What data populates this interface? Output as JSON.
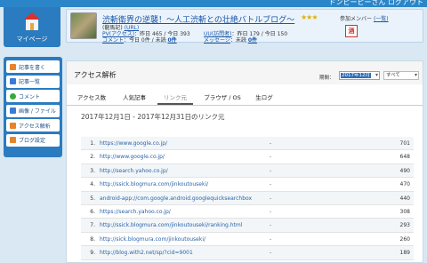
{
  "top": {
    "user_text": "ドンピーピーさん  ログアウト"
  },
  "mypage": {
    "label": "マイページ"
  },
  "sidebar": {
    "items": [
      {
        "label": "記事を書く",
        "color": "#e8832a"
      },
      {
        "label": "記事一覧",
        "color": "#3a7bd5"
      },
      {
        "label": "コメント",
        "color": "#3aa83a"
      },
      {
        "label": "画像 / ファイル",
        "color": "#3a7bd5"
      },
      {
        "label": "アクセス解析",
        "color": "#e8832a"
      },
      {
        "label": "ブログ設定",
        "color": "#e8832a"
      }
    ]
  },
  "profile": {
    "blog_title": "渋斬衛界の逆襲！～人工渋斬との壮絶バトルブログ～",
    "stars": "★★★",
    "sub_prefix": "(龍馬記)",
    "sub_link": "(URL)",
    "pv_label": "PV(アクセス)",
    "pv_text": "：昨日 465 / 今日 393",
    "uu_label": "UU(訪問者)",
    "uu_text": "：昨日 179 / 今日 150",
    "comment_label": "コメント",
    "comment_text": "：今日 0件 / 未読 ",
    "comment_unread": "0件",
    "message_label": "メッセージ",
    "message_text": "：未読 ",
    "message_unread": "0件",
    "members_label": "参加メンバー",
    "members_link": "(一覧)",
    "member_badge": "酒"
  },
  "main": {
    "title": "アクセス解析",
    "period_label": "期間：",
    "period_value": "2017年12月",
    "all_value": "すべて",
    "tabs": [
      "アクセス数",
      "人気記事",
      "リンク元",
      "ブラウザ / OS",
      "生ログ"
    ],
    "active_tab": "リンク元",
    "range_text": "2017年12月1日 - 2017年12月31日のリンク元",
    "rows": [
      {
        "n": "1.",
        "url": "https://www.google.co.jp/",
        "dash": "-",
        "count": "701"
      },
      {
        "n": "2.",
        "url": "http://www.google.co.jp/",
        "dash": "-",
        "count": "648"
      },
      {
        "n": "3.",
        "url": "http://search.yahoo.co.jp/",
        "dash": "-",
        "count": "490"
      },
      {
        "n": "4.",
        "url": "http://ssick.blogmura.com/jinkoutouseki/",
        "dash": "-",
        "count": "470"
      },
      {
        "n": "5.",
        "url": "android-app://com.google.android.googlequicksearchbox",
        "dash": "-",
        "count": "440"
      },
      {
        "n": "6.",
        "url": "https://search.yahoo.co.jp/",
        "dash": "-",
        "count": "308"
      },
      {
        "n": "7.",
        "url": "http://ssick.blogmura.com/jinkoutouseki/ranking.html",
        "dash": "-",
        "count": "293"
      },
      {
        "n": "8.",
        "url": "http://sick.blogmura.com/jinkoutouseki/",
        "dash": "-",
        "count": "260"
      },
      {
        "n": "9.",
        "url": "http://blog.with2.net/sp/?cid=9001",
        "dash": "-",
        "count": "189"
      }
    ]
  }
}
